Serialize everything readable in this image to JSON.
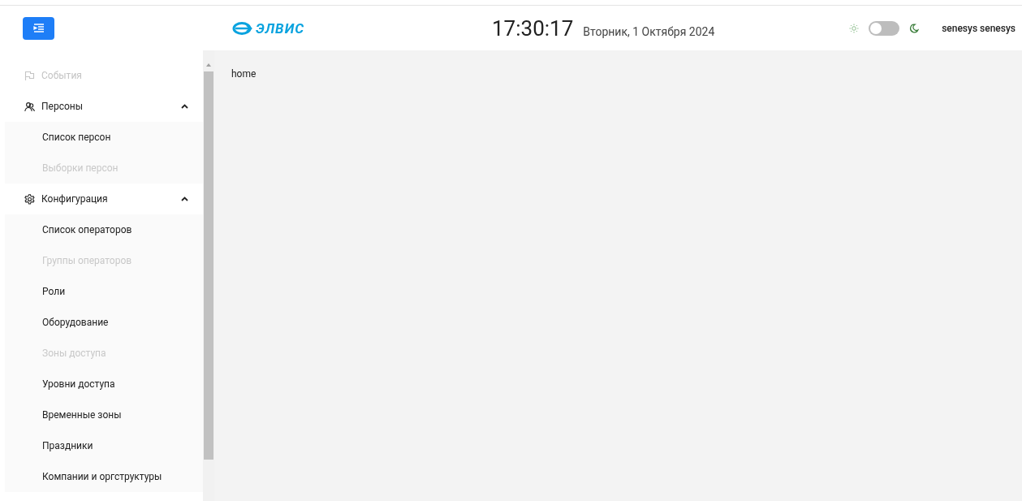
{
  "header": {
    "logo": "ЭЛВИС",
    "time": "17:30:17",
    "date": "Вторник, 1 Октября 2024",
    "theme_toggle": {
      "on": false
    },
    "user": "senesys senesys"
  },
  "sidebar": {
    "items": [
      {
        "label": "События",
        "kind": "flag",
        "disabled": true
      },
      {
        "label": "Персоны",
        "kind": "persons",
        "disabled": false,
        "expanded": true,
        "children": [
          {
            "label": "Список персон",
            "disabled": false
          },
          {
            "label": "Выборки персон",
            "disabled": true
          }
        ]
      },
      {
        "label": "Конфигурация",
        "kind": "gear",
        "disabled": false,
        "expanded": true,
        "children": [
          {
            "label": "Список операторов",
            "disabled": false
          },
          {
            "label": "Группы операторов",
            "disabled": true
          },
          {
            "label": "Роли",
            "disabled": false
          },
          {
            "label": "Оборудование",
            "disabled": false
          },
          {
            "label": "Зоны доступа",
            "disabled": true
          },
          {
            "label": "Уровни доступа",
            "disabled": false
          },
          {
            "label": "Временные зоны",
            "disabled": false
          },
          {
            "label": "Праздники",
            "disabled": false
          },
          {
            "label": "Компании и оргструктуры",
            "disabled": false
          }
        ]
      }
    ]
  },
  "content": {
    "text": "home"
  }
}
